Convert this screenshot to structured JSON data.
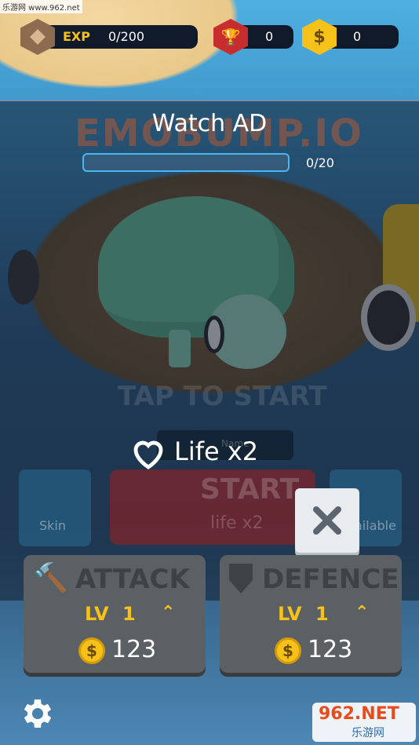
{
  "watermark_top": "乐游网 www.962.net",
  "hud": {
    "exp_label": "EXP",
    "exp_value": "0/200",
    "trophy_value": "0",
    "coin_value": "0"
  },
  "background": {
    "title_logo": "EMOBUMP.IO",
    "tap_hint": "TAP TO START",
    "name_hint": "Name",
    "skin_label": "Skin",
    "start_label": "START",
    "start_sub": "life x2",
    "right_label": "ailable"
  },
  "popup": {
    "title": "Watch AD",
    "progress_text": "0/20",
    "progress_fraction": 0,
    "reward_label": "Life x2",
    "close_icon": "close-icon"
  },
  "upgrades": [
    {
      "name": "ATTACK",
      "level_label": "LV",
      "level": "1",
      "cost": "123",
      "coin_symbol": "$"
    },
    {
      "name": "DEFENCE",
      "level_label": "LV",
      "level": "1",
      "cost": "123",
      "coin_symbol": "$"
    }
  ],
  "watermark_bottom": {
    "brand": "962.NET",
    "sub": "乐游网"
  },
  "colors": {
    "accent_yellow": "#f6c21a",
    "panel_dark": "#111a2b",
    "progress_border": "#4ab6f0",
    "close_bg": "#e8ecef"
  }
}
